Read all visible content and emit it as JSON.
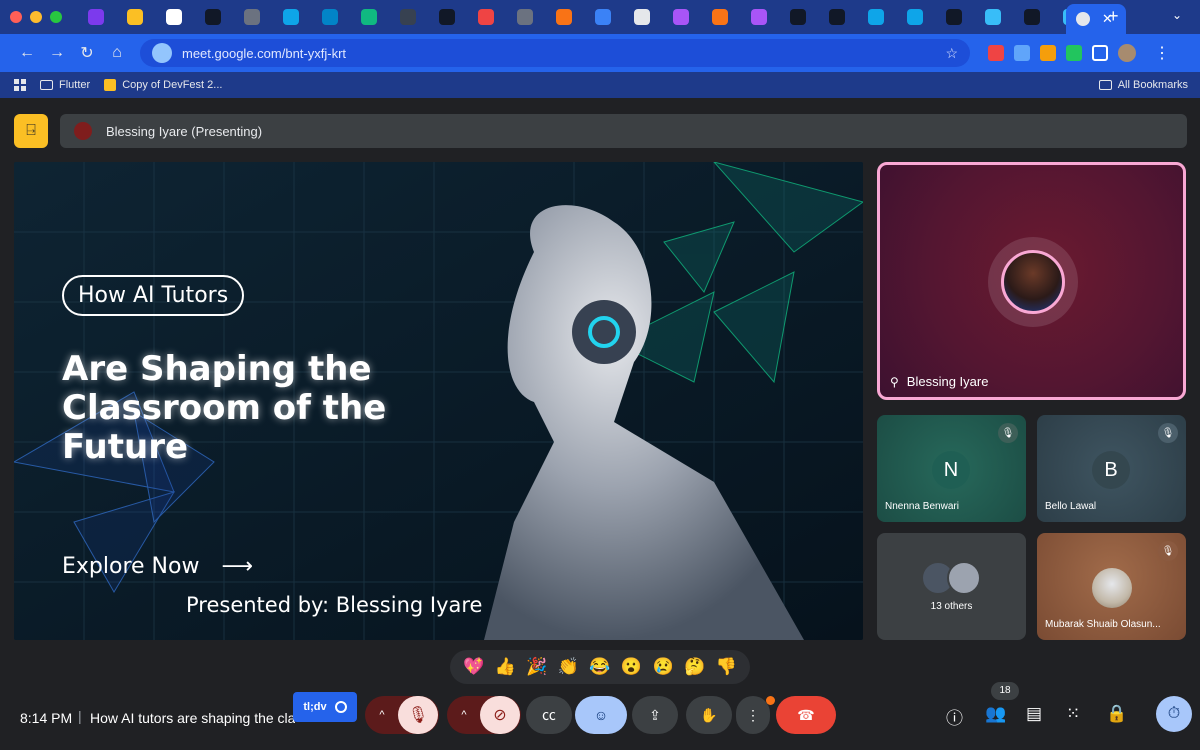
{
  "browser": {
    "url": "meet.google.com/bnt-yxfj-krt",
    "bookmarks": [
      "Flutter",
      "Copy of DevFest 2..."
    ],
    "all_bookmarks": "All Bookmarks",
    "tab_icons": [
      "u-icon",
      "docs-icon",
      "gmail-icon",
      "github-icon",
      "globe-icon",
      "gear-icon",
      "flutter-icon",
      "qt-icon",
      "code-icon",
      "github-icon",
      "star-icon",
      "chatgpt-icon",
      "sparkle-icon",
      "docs-icon",
      "doc-icon",
      "figma-icon",
      "c-icon",
      "figma-icon",
      "medium-icon",
      "github-icon",
      "circle-icon",
      "circle-icon",
      "github-icon",
      "flutter-icon",
      "github-icon",
      "flutter-icon",
      "chrome-icon"
    ]
  },
  "meet": {
    "presenting_label": "Blessing Iyare (Presenting)",
    "slide": {
      "pill": "How AI Tutors",
      "headline": "Are Shaping the Classroom of the Future",
      "explore": "Explore Now",
      "presented_by": "Presented by: Blessing Iyare"
    },
    "main_tile_name": "Blessing Iyare",
    "tiles": [
      {
        "initial": "N",
        "name": "Nnenna Benwari"
      },
      {
        "initial": "B",
        "name": "Bello Lawal"
      },
      {
        "others": "13 others"
      },
      {
        "name": "Mubarak Shuaib Olasun..."
      }
    ],
    "reactions": [
      "💖",
      "👍",
      "🎉",
      "👏",
      "😂",
      "😮",
      "😢",
      "🤔",
      "👎"
    ],
    "time": "8:14 PM",
    "meeting_title": "How AI tutors are shaping the cla",
    "tldv": "tl;dv",
    "participants_count": "18"
  }
}
